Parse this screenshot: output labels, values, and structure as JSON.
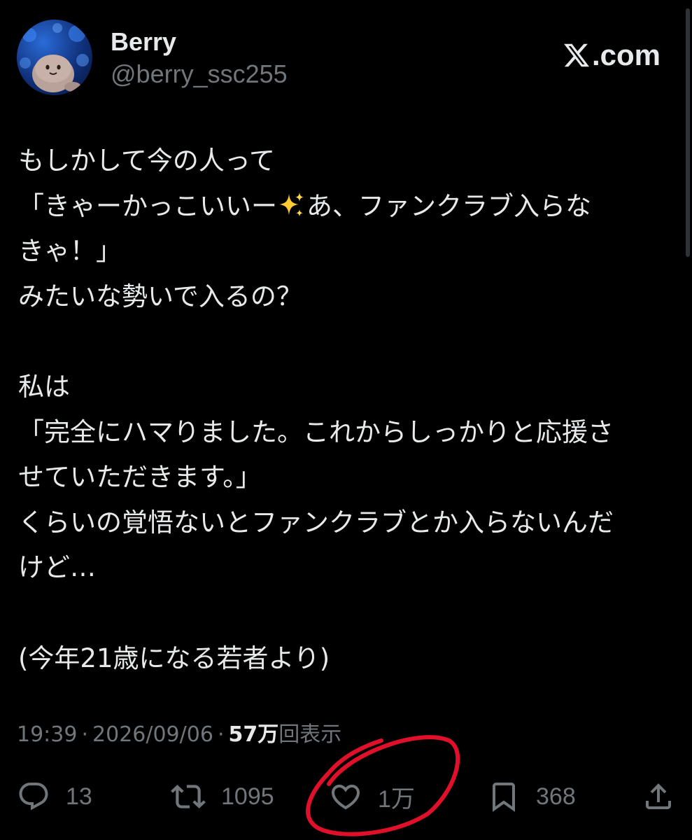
{
  "author": {
    "display_name": "Berry",
    "handle": "@berry_ssc255",
    "avatar_icon": "avatar-jellyfish-plush"
  },
  "brand": {
    "logo_icon": "x-logo-icon",
    "text": ".com"
  },
  "post": {
    "lines": [
      "もしかして今の人って",
      "「きゃーかっこいいー",
      "あ、ファンクラブ入らな",
      "きゃ！」",
      "みたいな勢いで入るの？",
      "",
      "私は",
      "「完全にハマりました。これからしっかりと応援さ",
      "せていただきます。」",
      "くらいの覚悟ないとファンクラブとか入らないんだ",
      "けど…",
      "",
      "(今年21歳になる若者より)"
    ],
    "emoji": "sparkles-icon"
  },
  "meta": {
    "time": "19:39",
    "dot": "·",
    "date": "2026/09/06",
    "views_count": "57万",
    "views_label": "回表示"
  },
  "actions": {
    "replies": "13",
    "reposts": "1095",
    "likes": "1万",
    "bookmarks": "368"
  },
  "colors": {
    "background": "#000000",
    "text": "#e7e9ea",
    "secondary": "#71767b",
    "annotation_circle": "#e0102a"
  }
}
